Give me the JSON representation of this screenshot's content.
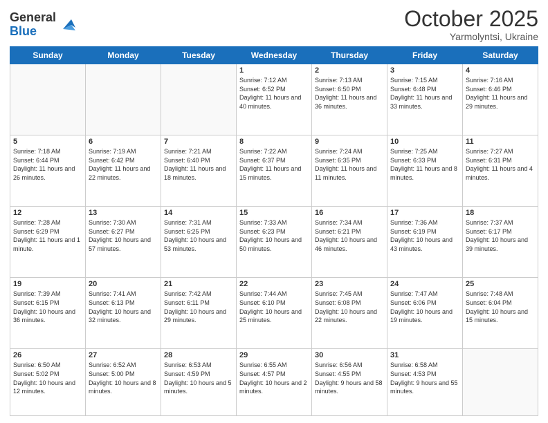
{
  "header": {
    "logo_general": "General",
    "logo_blue": "Blue",
    "month": "October 2025",
    "location": "Yarmolyntsi, Ukraine"
  },
  "days_of_week": [
    "Sunday",
    "Monday",
    "Tuesday",
    "Wednesday",
    "Thursday",
    "Friday",
    "Saturday"
  ],
  "weeks": [
    [
      {
        "day": "",
        "info": ""
      },
      {
        "day": "",
        "info": ""
      },
      {
        "day": "",
        "info": ""
      },
      {
        "day": "1",
        "info": "Sunrise: 7:12 AM\nSunset: 6:52 PM\nDaylight: 11 hours and 40 minutes."
      },
      {
        "day": "2",
        "info": "Sunrise: 7:13 AM\nSunset: 6:50 PM\nDaylight: 11 hours and 36 minutes."
      },
      {
        "day": "3",
        "info": "Sunrise: 7:15 AM\nSunset: 6:48 PM\nDaylight: 11 hours and 33 minutes."
      },
      {
        "day": "4",
        "info": "Sunrise: 7:16 AM\nSunset: 6:46 PM\nDaylight: 11 hours and 29 minutes."
      }
    ],
    [
      {
        "day": "5",
        "info": "Sunrise: 7:18 AM\nSunset: 6:44 PM\nDaylight: 11 hours and 26 minutes."
      },
      {
        "day": "6",
        "info": "Sunrise: 7:19 AM\nSunset: 6:42 PM\nDaylight: 11 hours and 22 minutes."
      },
      {
        "day": "7",
        "info": "Sunrise: 7:21 AM\nSunset: 6:40 PM\nDaylight: 11 hours and 18 minutes."
      },
      {
        "day": "8",
        "info": "Sunrise: 7:22 AM\nSunset: 6:37 PM\nDaylight: 11 hours and 15 minutes."
      },
      {
        "day": "9",
        "info": "Sunrise: 7:24 AM\nSunset: 6:35 PM\nDaylight: 11 hours and 11 minutes."
      },
      {
        "day": "10",
        "info": "Sunrise: 7:25 AM\nSunset: 6:33 PM\nDaylight: 11 hours and 8 minutes."
      },
      {
        "day": "11",
        "info": "Sunrise: 7:27 AM\nSunset: 6:31 PM\nDaylight: 11 hours and 4 minutes."
      }
    ],
    [
      {
        "day": "12",
        "info": "Sunrise: 7:28 AM\nSunset: 6:29 PM\nDaylight: 11 hours and 1 minute."
      },
      {
        "day": "13",
        "info": "Sunrise: 7:30 AM\nSunset: 6:27 PM\nDaylight: 10 hours and 57 minutes."
      },
      {
        "day": "14",
        "info": "Sunrise: 7:31 AM\nSunset: 6:25 PM\nDaylight: 10 hours and 53 minutes."
      },
      {
        "day": "15",
        "info": "Sunrise: 7:33 AM\nSunset: 6:23 PM\nDaylight: 10 hours and 50 minutes."
      },
      {
        "day": "16",
        "info": "Sunrise: 7:34 AM\nSunset: 6:21 PM\nDaylight: 10 hours and 46 minutes."
      },
      {
        "day": "17",
        "info": "Sunrise: 7:36 AM\nSunset: 6:19 PM\nDaylight: 10 hours and 43 minutes."
      },
      {
        "day": "18",
        "info": "Sunrise: 7:37 AM\nSunset: 6:17 PM\nDaylight: 10 hours and 39 minutes."
      }
    ],
    [
      {
        "day": "19",
        "info": "Sunrise: 7:39 AM\nSunset: 6:15 PM\nDaylight: 10 hours and 36 minutes."
      },
      {
        "day": "20",
        "info": "Sunrise: 7:41 AM\nSunset: 6:13 PM\nDaylight: 10 hours and 32 minutes."
      },
      {
        "day": "21",
        "info": "Sunrise: 7:42 AM\nSunset: 6:11 PM\nDaylight: 10 hours and 29 minutes."
      },
      {
        "day": "22",
        "info": "Sunrise: 7:44 AM\nSunset: 6:10 PM\nDaylight: 10 hours and 25 minutes."
      },
      {
        "day": "23",
        "info": "Sunrise: 7:45 AM\nSunset: 6:08 PM\nDaylight: 10 hours and 22 minutes."
      },
      {
        "day": "24",
        "info": "Sunrise: 7:47 AM\nSunset: 6:06 PM\nDaylight: 10 hours and 19 minutes."
      },
      {
        "day": "25",
        "info": "Sunrise: 7:48 AM\nSunset: 6:04 PM\nDaylight: 10 hours and 15 minutes."
      }
    ],
    [
      {
        "day": "26",
        "info": "Sunrise: 6:50 AM\nSunset: 5:02 PM\nDaylight: 10 hours and 12 minutes."
      },
      {
        "day": "27",
        "info": "Sunrise: 6:52 AM\nSunset: 5:00 PM\nDaylight: 10 hours and 8 minutes."
      },
      {
        "day": "28",
        "info": "Sunrise: 6:53 AM\nSunset: 4:59 PM\nDaylight: 10 hours and 5 minutes."
      },
      {
        "day": "29",
        "info": "Sunrise: 6:55 AM\nSunset: 4:57 PM\nDaylight: 10 hours and 2 minutes."
      },
      {
        "day": "30",
        "info": "Sunrise: 6:56 AM\nSunset: 4:55 PM\nDaylight: 9 hours and 58 minutes."
      },
      {
        "day": "31",
        "info": "Sunrise: 6:58 AM\nSunset: 4:53 PM\nDaylight: 9 hours and 55 minutes."
      },
      {
        "day": "",
        "info": ""
      }
    ]
  ]
}
